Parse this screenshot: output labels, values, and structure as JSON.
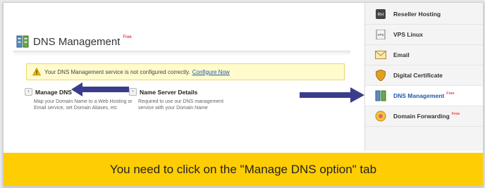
{
  "page": {
    "title": "DNS Management",
    "title_free_tag": "Free"
  },
  "warning": {
    "message": "Your DNS Management service is not configured correctly.",
    "link_label": "Configure Now"
  },
  "options": [
    {
      "title": "Manage DNS",
      "description": "Map your Domain Name to a Web Hosting or Email service, set Domain Aliases, etc"
    },
    {
      "title": "Name Server Details",
      "description": "Required to use our DNS management service with your Domain Name"
    }
  ],
  "menu": {
    "items": [
      {
        "label": "Reseller Hosting",
        "icon": "rh-icon",
        "free": ""
      },
      {
        "label": "VPS Linux",
        "icon": "vps-icon",
        "free": ""
      },
      {
        "label": "Email",
        "icon": "envelope-icon",
        "free": ""
      },
      {
        "label": "Digital Certificate",
        "icon": "shield-icon",
        "free": ""
      },
      {
        "label": "DNS Management",
        "icon": "dns-icon",
        "free": "Free"
      },
      {
        "label": "Domain Forwarding",
        "icon": "forwarding-icon",
        "free": "Free"
      }
    ],
    "active_index": 4
  },
  "caption": {
    "text": "You need to click on the \"Manage DNS option\" tab"
  },
  "colors": {
    "caption_bg": "#ffcd03",
    "arrow": "#3a3d8c",
    "free_tag": "#e00000",
    "link": "#1f58a8",
    "warning_bg": "#fffbcc"
  }
}
